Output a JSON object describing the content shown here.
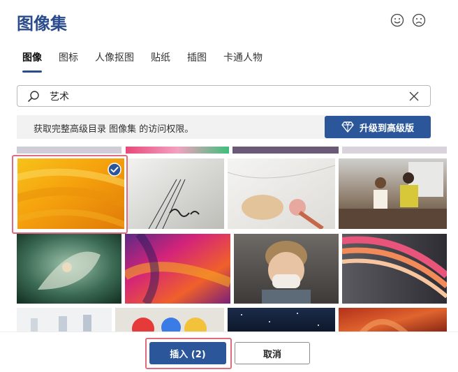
{
  "dialog": {
    "title": "图像集"
  },
  "feedback": {
    "smile_icon": "smile-icon",
    "frown_icon": "frown-icon"
  },
  "tabs": [
    {
      "label": "图像",
      "active": true
    },
    {
      "label": "图标",
      "active": false
    },
    {
      "label": "人像抠图",
      "active": false
    },
    {
      "label": "贴纸",
      "active": false
    },
    {
      "label": "插图",
      "active": false
    },
    {
      "label": "卡通人物",
      "active": false
    }
  ],
  "search": {
    "value": "艺术",
    "placeholder": ""
  },
  "banner": {
    "text": "获取完整高级目录 图像集 的访问权限。",
    "upgrade_label": "升级到高级版"
  },
  "actions": {
    "insert_label": "插入 (2)",
    "cancel_label": "取消"
  },
  "colors": {
    "accent": "#2b579a",
    "title": "#2b4c8c",
    "selection_frame": "#e06a7f",
    "banner_bg": "#f2f2f2"
  }
}
